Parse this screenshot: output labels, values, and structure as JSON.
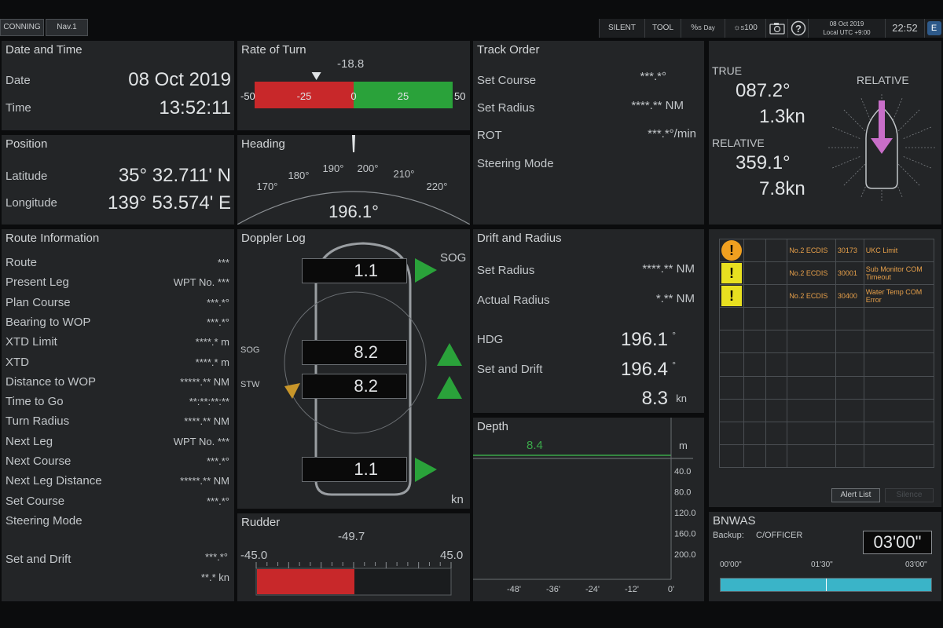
{
  "topbar": {
    "tabs": [
      "CONNING",
      "Nav.1"
    ],
    "buttons": [
      "SILENT",
      "TOOL"
    ],
    "mode_s": "S",
    "mode_day": "Day",
    "brightness_s": "S",
    "brightness_val": "100",
    "camera_icon": "camera-icon",
    "help_icon": "question-icon",
    "date": "08 Oct 2019",
    "utc": "Local UTC +9:00",
    "time": "22:52",
    "menu_label": "E"
  },
  "date_time": {
    "title": "Date and Time",
    "date_label": "Date",
    "date_value": "08 Oct 2019",
    "time_label": "Time",
    "time_value": "13:52:11"
  },
  "position": {
    "title": "Position",
    "lat_label": "Latitude",
    "lat_value": "35° 32.711' N",
    "lon_label": "Longitude",
    "lon_value": "139° 53.574' E"
  },
  "rate_of_turn": {
    "title": "Rate of Turn",
    "value": "-18.8",
    "min_label": "-50",
    "max_label": "50",
    "ticks": [
      "-25",
      "0",
      "25"
    ],
    "min": -50,
    "max": 50,
    "current": -18.8,
    "neg_color": "#c8282a",
    "pos_color": "#2aa23a"
  },
  "heading": {
    "title": "Heading",
    "value": "196.1°",
    "ticks": [
      "170°",
      "180°",
      "190°",
      "200°",
      "210°",
      "220°"
    ]
  },
  "track_order": {
    "title": "Track Order",
    "rows": [
      {
        "label": "Set Course",
        "value": "***.*°"
      },
      {
        "label": "Set Radius",
        "value": "****.** NM"
      },
      {
        "label": "ROT",
        "value": "***.*°/min"
      },
      {
        "label": "Steering Mode",
        "value": ""
      }
    ]
  },
  "relative_wind": {
    "true_label": "TRUE",
    "true_dir": "087.2°",
    "true_speed": "1.3kn",
    "relative_label": "RELATIVE",
    "rel_dir": "359.1°",
    "rel_speed": "7.8kn",
    "relative_header": "RELATIVE",
    "arrow_color": "#c86ec8"
  },
  "route_info": {
    "title": "Route Information",
    "rows": [
      {
        "label": "Route",
        "value": "***"
      },
      {
        "label": "Present Leg",
        "value": "WPT No. ***"
      },
      {
        "label": "Plan Course",
        "value": "***.*°"
      },
      {
        "label": "Bearing to WOP",
        "value": "***.*°"
      },
      {
        "label": "XTD Limit",
        "value": "****.* m"
      },
      {
        "label": "XTD",
        "value": "****.* m"
      },
      {
        "label": "Distance to WOP",
        "value": "*****.** NM"
      },
      {
        "label": "Time to Go",
        "value": "**:**:**:**"
      },
      {
        "label": "Turn Radius",
        "value": "****.** NM"
      },
      {
        "label": "Next Leg",
        "value": "WPT No. ***"
      },
      {
        "label": "Next Course",
        "value": "***.*°"
      },
      {
        "label": "Next Leg Distance",
        "value": "*****.** NM"
      },
      {
        "label": "Set Course",
        "value": "***.*°"
      },
      {
        "label": "Steering Mode",
        "value": ""
      }
    ],
    "set_drift_label": "Set and Drift",
    "set_drift_dir": "***.*°",
    "set_drift_speed": "**.* kn"
  },
  "doppler_log": {
    "title": "Doppler Log",
    "sog_label": "SOG",
    "bow_speed": "1.1",
    "sog_side_label": "SOG",
    "stw_side_label": "STW",
    "sog_value": "8.2",
    "stw_value": "8.2",
    "stern_speed": "1.1",
    "unit": "kn",
    "arrow_color": "#2aa23a"
  },
  "drift_radius": {
    "title": "Drift and Radius",
    "set_radius_label": "Set Radius",
    "set_radius_value": "****.** NM",
    "actual_radius_label": "Actual Radius",
    "actual_radius_value": "*.** NM",
    "hdg_label": "HDG",
    "hdg_value": "196.1",
    "hdg_unit": "°",
    "set_drift_label": "Set and Drift",
    "set_drift_value": "196.4",
    "set_drift_unit": "°",
    "drift_speed": "8.3",
    "drift_unit": "kn"
  },
  "alerts": {
    "rows": [
      {
        "level": "warning",
        "source": "No.2 ECDIS",
        "code": "30173",
        "message": "UKC Limit"
      },
      {
        "level": "caution",
        "source": "No.2 ECDIS",
        "code": "30001",
        "message": "Sub Monitor COM Timeout"
      },
      {
        "level": "caution",
        "source": "No.2 ECDIS",
        "code": "30400",
        "message": "Water Temp COM Error"
      }
    ],
    "warning_color": "#f0a020",
    "caution_color": "#e8e020",
    "alert_list_button": "Alert List",
    "silence_button": "Silence"
  },
  "rudder": {
    "title": "Rudder",
    "value": "-49.7",
    "min_label": "-45.0",
    "max_label": "45.0",
    "min": -45,
    "max": 45,
    "current": -49.7,
    "bar_color": "#c8282a"
  },
  "depth": {
    "title": "Depth",
    "value": "8.4",
    "unit": "m",
    "y_ticks": [
      "40.0",
      "80.0",
      "120.0",
      "160.0",
      "200.0"
    ],
    "x_ticks": [
      "-48'",
      "-36'",
      "-24'",
      "-12'",
      "0'"
    ],
    "line_color": "#3aa84a"
  },
  "bnwas": {
    "title": "BNWAS",
    "backup_label": "Backup:",
    "backup_value": "C/OFFICER",
    "timer": "03'00\"",
    "scale": [
      "00'00\"",
      "01'30\"",
      "03'00\""
    ],
    "progress": 1.0,
    "bar_color": "#3ab4c8"
  }
}
